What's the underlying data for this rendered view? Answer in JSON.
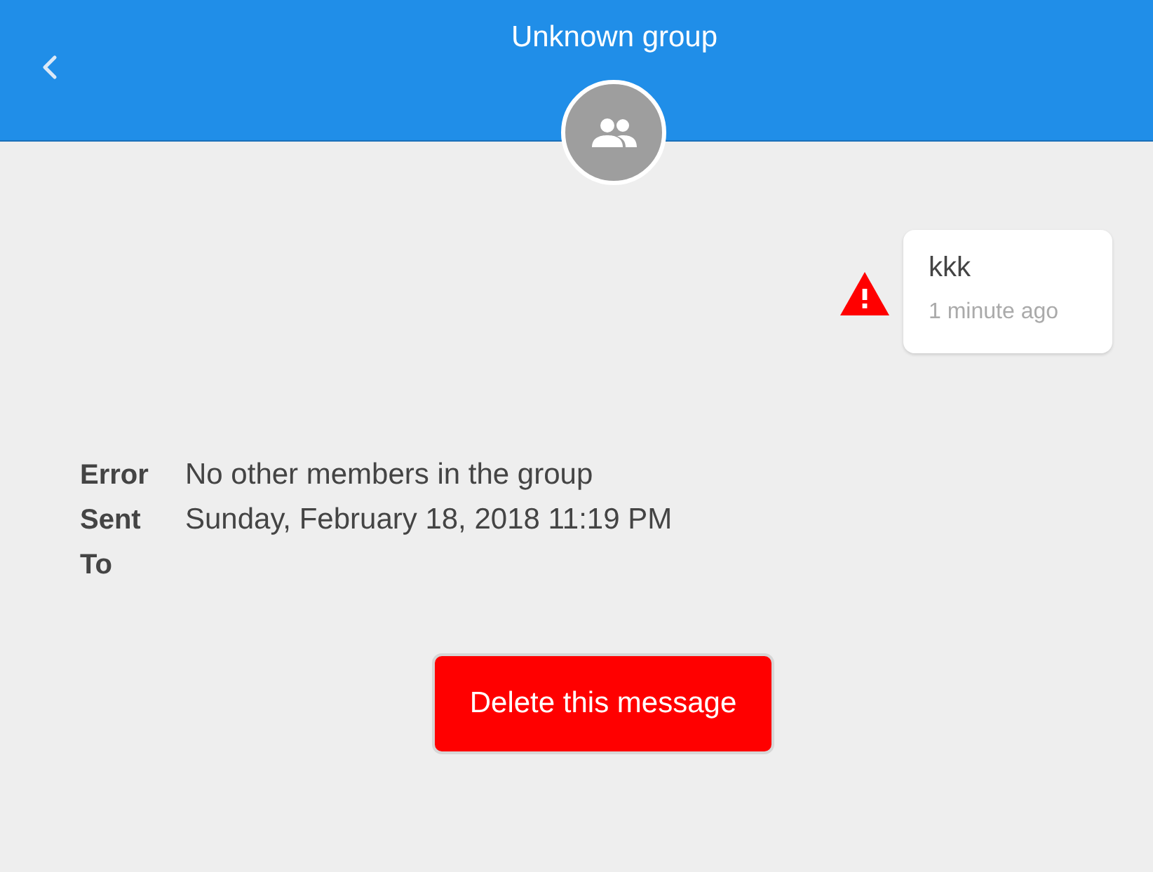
{
  "header": {
    "title": "Unknown group"
  },
  "message": {
    "text": "kkk",
    "time": "1 minute ago",
    "failed": true
  },
  "details": [
    {
      "label": "Error",
      "value": "No other members in the group"
    },
    {
      "label": "Sent",
      "value": "Sunday, February 18, 2018 11:19 PM"
    },
    {
      "label": "To"
    }
  ],
  "delete_button": {
    "label": "Delete this message"
  }
}
